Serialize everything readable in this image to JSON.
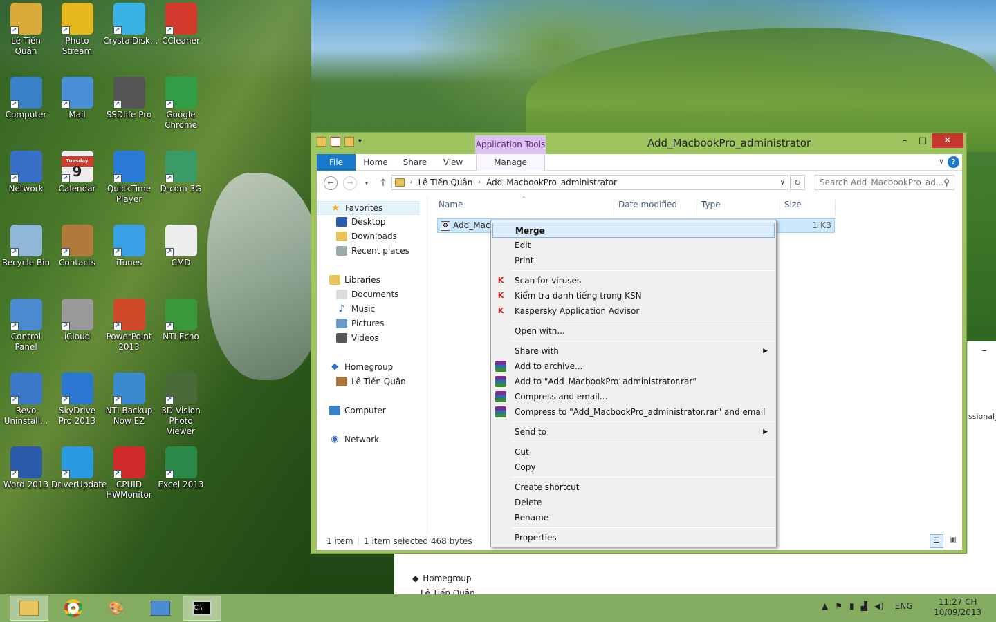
{
  "desktop": {
    "icons": [
      {
        "label": "Lê Tiến Quân",
        "icon": "user-folder-icon",
        "color": "#d9a93a"
      },
      {
        "label": "Photo Stream",
        "icon": "sunflower-icon",
        "color": "#e6b820"
      },
      {
        "label": "CrystalDisk...",
        "icon": "crystal-icon",
        "color": "#39b2e5"
      },
      {
        "label": "CCleaner",
        "icon": "ccleaner-icon",
        "color": "#d23b2b"
      },
      {
        "label": "Computer",
        "icon": "monitor-icon",
        "color": "#3a82c8"
      },
      {
        "label": "Mail",
        "icon": "mail-icon",
        "color": "#4a90d9"
      },
      {
        "label": "SSDlife Pro",
        "icon": "ssd-icon",
        "color": "#555555"
      },
      {
        "label": "Google Chrome",
        "icon": "chrome-icon",
        "color": "#2f9e44"
      },
      {
        "label": "Network",
        "icon": "globe-icon",
        "color": "#3a6fc8"
      },
      {
        "label": "Calendar",
        "icon": "calendar-icon",
        "color": "#eeeeee"
      },
      {
        "label": "QuickTime Player",
        "icon": "quicktime-icon",
        "color": "#2a7bd6"
      },
      {
        "label": "D-com 3G",
        "icon": "dcom-icon",
        "color": "#3a9a68"
      },
      {
        "label": "Recycle Bin",
        "icon": "recycle-bin-icon",
        "color": "#8fb8d8"
      },
      {
        "label": "Contacts",
        "icon": "contacts-icon",
        "color": "#b07a3a"
      },
      {
        "label": "iTunes",
        "icon": "itunes-icon",
        "color": "#3aa0e6"
      },
      {
        "label": "CMD",
        "icon": "cmd-icon",
        "color": "#eeeeee"
      },
      {
        "label": "Control Panel",
        "icon": "control-panel-icon",
        "color": "#4a8ad0"
      },
      {
        "label": "iCloud",
        "icon": "icloud-icon",
        "color": "#9a9a9a"
      },
      {
        "label": "PowerPoint 2013",
        "icon": "powerpoint-icon",
        "color": "#d04a2a"
      },
      {
        "label": "NTI Echo",
        "icon": "nti-echo-icon",
        "color": "#3a9a3a"
      },
      {
        "label": "Revo Uninstall...",
        "icon": "revo-icon",
        "color": "#3a7ac8"
      },
      {
        "label": "SkyDrive Pro 2013",
        "icon": "skydrive-icon",
        "color": "#2a78d0"
      },
      {
        "label": "NTI Backup Now EZ",
        "icon": "nti-backup-icon",
        "color": "#3a8ad0"
      },
      {
        "label": "3D Vision Photo Viewer",
        "icon": "3d-vision-icon",
        "color": "#4a6a3a"
      },
      {
        "label": "Word 2013",
        "icon": "word-icon",
        "color": "#2a5aa8"
      },
      {
        "label": "DriverUpdate",
        "icon": "download-icon",
        "color": "#2a9ae0"
      },
      {
        "label": "CPUID HWMonitor",
        "icon": "hwmonitor-icon",
        "color": "#d02a2a"
      },
      {
        "label": "Excel 2013",
        "icon": "excel-icon",
        "color": "#2a8a4a"
      }
    ],
    "calendar_day": "Tuesday",
    "calendar_num": "9"
  },
  "window": {
    "title": "Add_MacbookPro_administrator",
    "context_tab": "Application Tools",
    "tabs": {
      "file": "File",
      "home": "Home",
      "share": "Share",
      "view": "View",
      "manage": "Manage"
    },
    "breadcrumb": [
      "Lê Tiến Quân",
      "Add_MacbookPro_administrator"
    ],
    "search_placeholder": "Search Add_MacbookPro_ad...",
    "nav": {
      "favorites": "Favorites",
      "desktop": "Desktop",
      "downloads": "Downloads",
      "recent": "Recent places",
      "libraries": "Libraries",
      "documents": "Documents",
      "music": "Music",
      "pictures": "Pictures",
      "videos": "Videos",
      "homegroup": "Homegroup",
      "user": "Lê Tiến Quân",
      "computer": "Computer",
      "network": "Network"
    },
    "columns": {
      "name": "Name",
      "date": "Date modified",
      "type": "Type",
      "size": "Size"
    },
    "file": {
      "name": "Add_Macbo",
      "size": "1 KB"
    },
    "status": {
      "count": "1 item",
      "selected": "1 item selected  468 bytes"
    }
  },
  "context_menu": {
    "merge": "Merge",
    "edit": "Edit",
    "print": "Print",
    "scan": "Scan for viruses",
    "ksn": "Kiểm tra danh tiếng trong KSN",
    "advisor": "Kaspersky Application Advisor",
    "open_with": "Open with...",
    "share_with": "Share with",
    "add_archive": "Add to archive...",
    "add_rar": "Add to \"Add_MacbookPro_administrator.rar\"",
    "compress_email": "Compress and email...",
    "compress_rar_email": "Compress to \"Add_MacbookPro_administrator.rar\" and email",
    "send_to": "Send to",
    "cut": "Cut",
    "copy": "Copy",
    "create_shortcut": "Create shortcut",
    "delete": "Delete",
    "rename": "Rename",
    "properties": "Properties"
  },
  "background_window": {
    "homegroup": "Homegroup",
    "user": "Lê Tiến Quân",
    "partial_text": "ssional_p"
  },
  "taskbar": {
    "lang": "ENG",
    "time": "11:27 CH",
    "date": "10/09/2013"
  }
}
